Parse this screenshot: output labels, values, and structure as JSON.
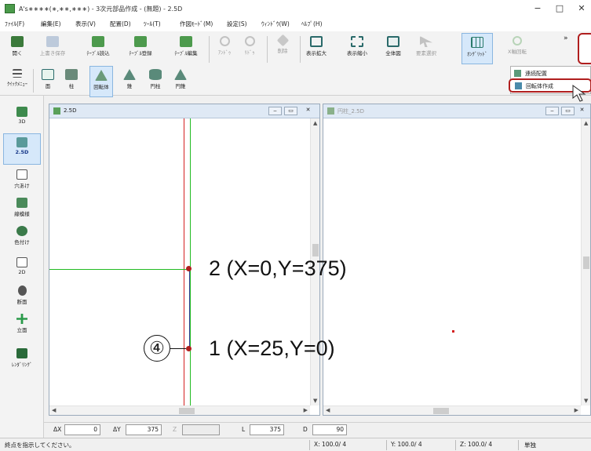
{
  "window": {
    "title": "A's∗∗∗∗(∗,∗∗,∗∗∗) - 3次元部品作成 - (無題) - 2.5D",
    "minimize": "−",
    "maximize": "□",
    "close": "✕"
  },
  "menu": [
    "ﾌｧｲﾙ(F)",
    "編集(E)",
    "表示(V)",
    "配置(D)",
    "ﾂｰﾙ(T)",
    "作図ﾓｰﾄﾞ(M)",
    "設定(S)",
    "ｳｨﾝﾄﾞｳ(W)",
    "ﾍﾙﾌﾟ(H)"
  ],
  "toolbar1": {
    "open": "開く",
    "overwrite": "上書き保存",
    "table_load": "ﾃｰﾌﾞﾙ読込",
    "table_register": "ﾃｰﾌﾞﾙ登録",
    "table_edit": "ﾃｰﾌﾞﾙ編集",
    "undo": "ｱﾝﾄﾞｩ",
    "redo": "ﾘﾄﾞｩ",
    "delete": "削除",
    "zoom_in": "表示拡大",
    "zoom_out": "表示縮小",
    "fit_all": "全体図",
    "select": "要素選択",
    "on_grid": "ｵﾝｸﾞﾘｯﾄﾞ",
    "x_axis_rotate": "X軸回転",
    "overflow": "»"
  },
  "toolbar2": {
    "quick_menu": "ｸｲｯｸﾒﾆｭｰ",
    "face": "面",
    "pillar": "柱",
    "revolve": "回転体",
    "cone": "錐",
    "cylinder": "円柱",
    "cone_pillar": "円錐"
  },
  "dropdown": {
    "continuous_place": "連続配置",
    "revolve_create": "回転体作成"
  },
  "left_panel": [
    "3D",
    "2.5D",
    "穴あけ",
    "線模様",
    "色付け",
    "2D",
    "断面",
    "立面",
    "ﾚﾝﾀﾞﾘﾝｸﾞ"
  ],
  "view_left": {
    "title": "2.5D"
  },
  "view_right": {
    "title": "円柱_2.5D"
  },
  "coords": {
    "dx_label": "ΔX",
    "dx_value": "0",
    "dy_label": "ΔY",
    "dy_value": "375",
    "z_label": "Z",
    "z_value": "",
    "l_label": "L",
    "l_value": "375",
    "d_label": "D",
    "d_value": "90"
  },
  "status": {
    "message": "終点を指示してください。",
    "x": "X: 100.0/ 4",
    "y": "Y: 100.0/ 4",
    "z": "Z: 100.0/ 4",
    "unit": "単独"
  },
  "annotations": {
    "point2": "2 (X=0,Y=375)",
    "point1": "1 (X=25,Y=0)",
    "step": "④"
  },
  "colors": {
    "accent_red": "#b01e1e",
    "green_line": "#22bb22",
    "red_line": "#d42020",
    "blue_segment": "#3a3aa0"
  }
}
